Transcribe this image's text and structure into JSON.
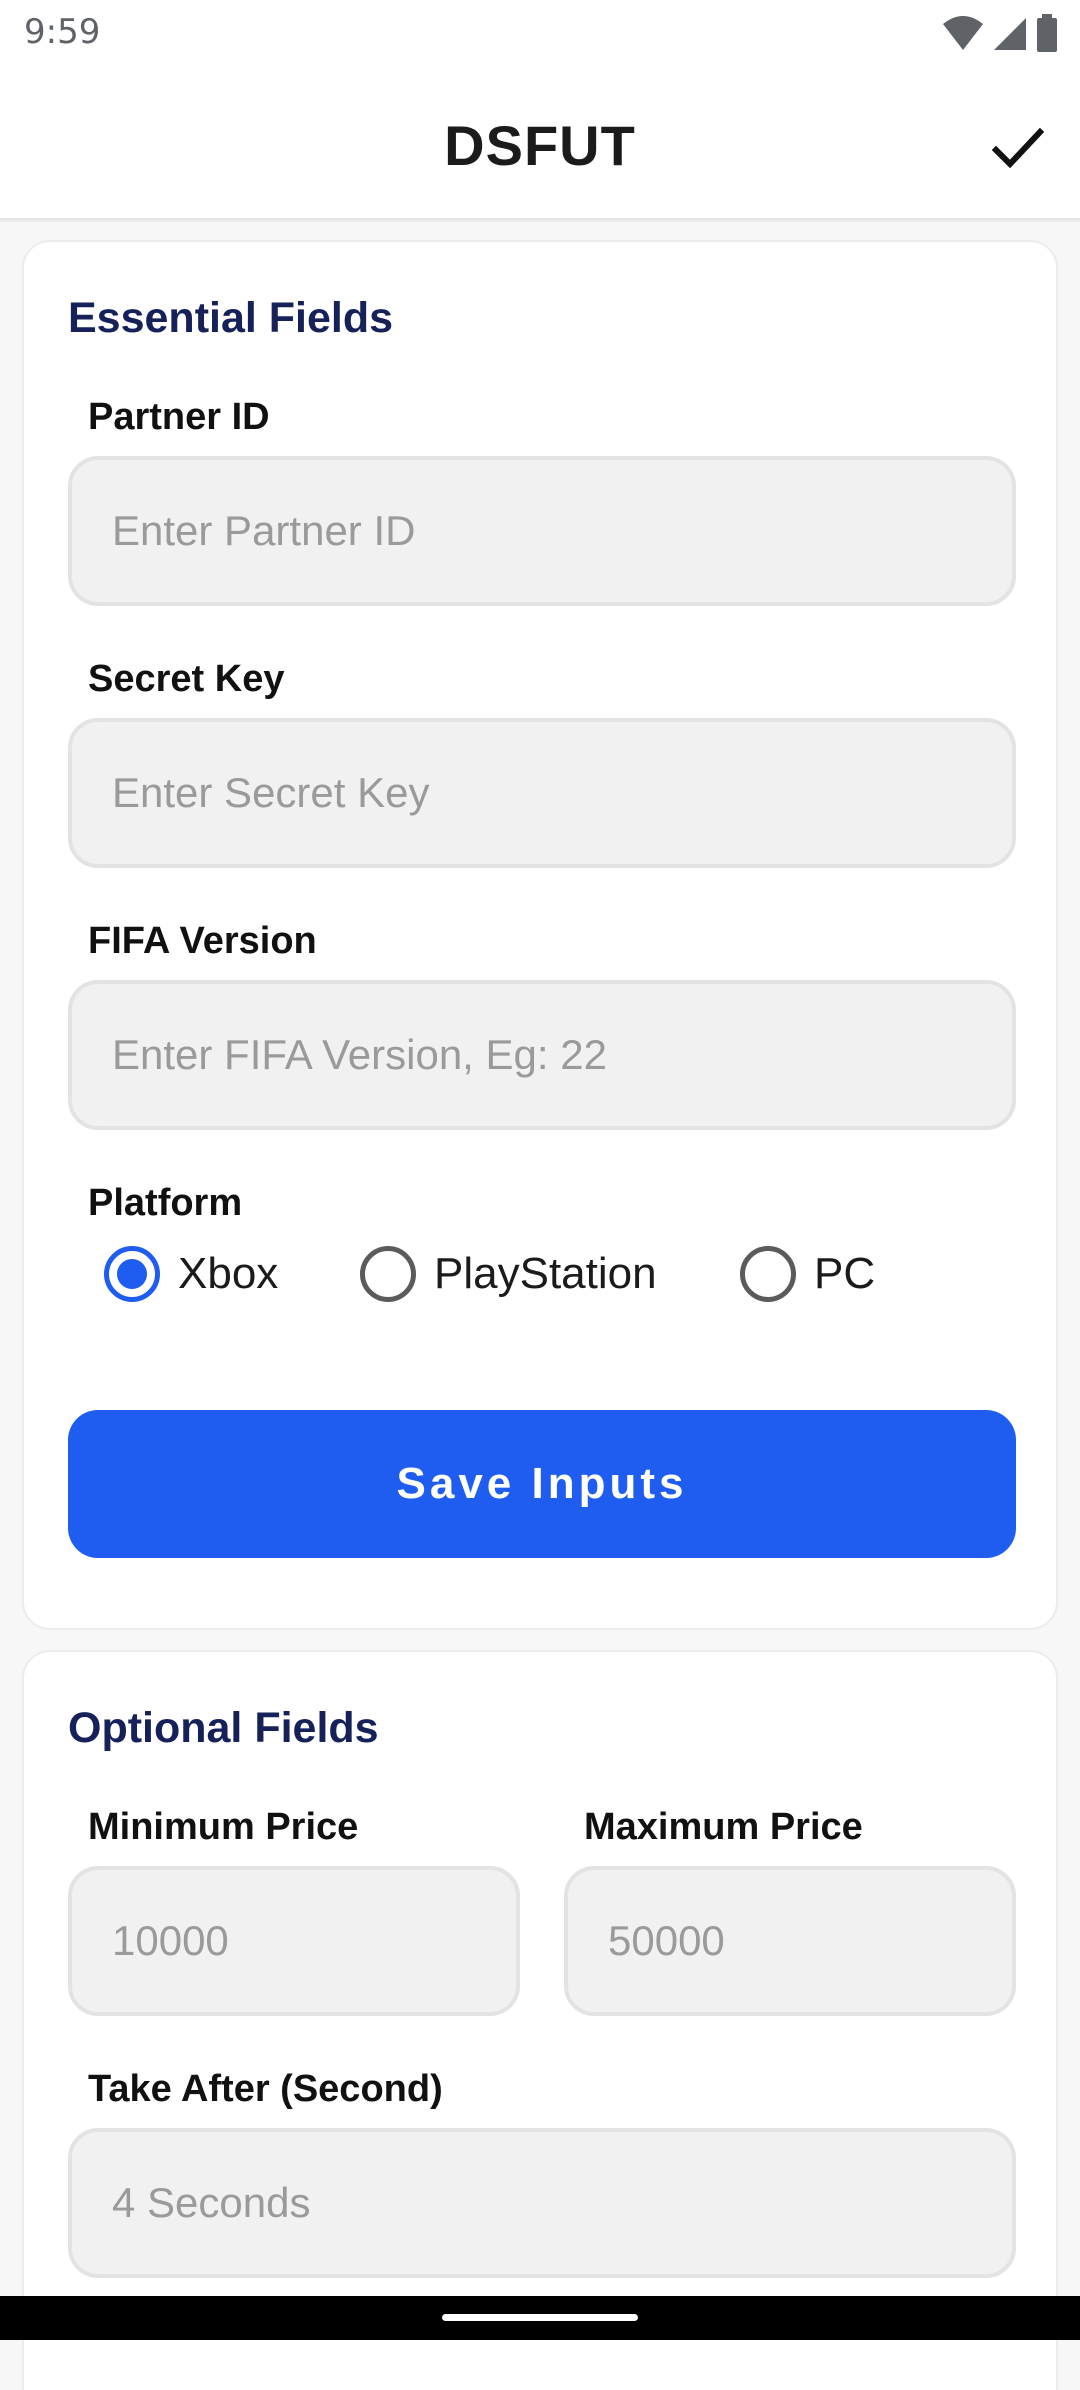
{
  "status_bar": {
    "time": "9:59",
    "icons": [
      "wifi-icon",
      "signal-icon",
      "battery-icon"
    ]
  },
  "app_bar": {
    "title": "DSFUT",
    "confirm_icon": "check-icon"
  },
  "essential": {
    "title": "Essential Fields",
    "partner_id": {
      "label": "Partner ID",
      "value": "",
      "placeholder": "Enter Partner ID"
    },
    "secret_key": {
      "label": "Secret Key",
      "value": "",
      "placeholder": "Enter Secret Key"
    },
    "fifa_version": {
      "label": "FIFA Version",
      "value": "",
      "placeholder": "Enter FIFA Version, Eg: 22"
    },
    "platform": {
      "label": "Platform",
      "options": [
        "Xbox",
        "PlayStation",
        "PC"
      ],
      "selected": "Xbox"
    },
    "save_label": "Save Inputs"
  },
  "optional": {
    "title": "Optional Fields",
    "min_price": {
      "label": "Minimum Price",
      "value": "",
      "placeholder": "10000"
    },
    "max_price": {
      "label": "Maximum Price",
      "value": "",
      "placeholder": "50000"
    },
    "take_after": {
      "label": "Take After (Second)",
      "value": "",
      "placeholder": "4 Seconds"
    }
  },
  "colors": {
    "accent": "#1e5df0",
    "section_title": "#16215a",
    "field_bg": "#f1f1f1"
  }
}
